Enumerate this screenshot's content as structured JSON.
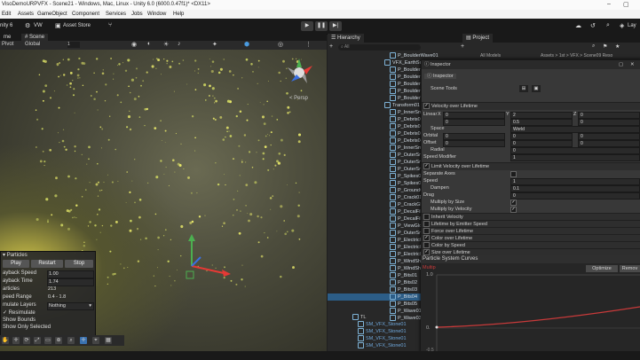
{
  "window": {
    "title": "VisoDemoURPVFX - Scene21 - Windows, Mac, Linux - Unity 6.0 (6000.0.47f1)* <DX11>"
  },
  "menubar": [
    "Edit",
    "Assets",
    "GameObject",
    "Component",
    "Services",
    "Jobs",
    "Window",
    "Help"
  ],
  "toolbar": {
    "account": "nity 6",
    "vw": "VW",
    "asset_store": "Asset Store",
    "layers": "Lay"
  },
  "tabs": {
    "scene_prefix": "me",
    "scene": "Scene",
    "hierarchy": "Hierarchy",
    "project": "Project"
  },
  "scene_toolbar": {
    "pivot": "Pivot",
    "global": "Global",
    "snap": "1"
  },
  "gizmo": {
    "label": "< Persp"
  },
  "hierarchy": {
    "search_placeholder": "All",
    "items": [
      "P_BoulderWave01",
      "VFX_EarthSum",
      "P_BoulderBa",
      "P_BoulderBa",
      "P_BoulderEm",
      "P_BoulderBa",
      "P_BoulderWa",
      "Transform01",
      "P_InnerSmok",
      "P_Debris01",
      "P_Debris03",
      "P_Debris02",
      "P_Debris04",
      "P_InnerSmok",
      "P_OuterSmok",
      "P_OuterSmok",
      "P_OuterSmok",
      "P_Spikes01",
      "P_Spikes02",
      "P_GroundGlo",
      "P_Crack01",
      "P_CrackGlow",
      "P_DecalFill01",
      "P_DecalFill01",
      "P_ViewGlow",
      "P_OuterSmok",
      "P_Electric01",
      "P_Electric02",
      "P_Electric03",
      "P_WindShock",
      "P_WindShock",
      "P_Bits01",
      "P_Bits02",
      "P_Bits03",
      "P_Bits04",
      "P_Bits05",
      "P_Wave01",
      "P_Wave03"
    ],
    "footer_items": [
      "TL",
      "SM_VFX_Stone01",
      "SM_VFX_Stone01",
      "SM_VFX_Stone01",
      "SM_VFX_Stone01"
    ]
  },
  "project": {
    "breadcrumb": "Assets > 1st > VFX > Scene09 Reso",
    "all_models": "All Models"
  },
  "inspector": {
    "window_title": "Inspector",
    "tab": "Inspector",
    "scene_tools": "Scene Tools",
    "velocity_over_lifetime": "Velocity over Lifetime",
    "linear": {
      "label": "Linear",
      "x": "0",
      "y": "2",
      "z": "0"
    },
    "linear_row2": {
      "x": "0",
      "y": "0.5",
      "z": "0"
    },
    "space": {
      "label": "Space",
      "value": "World"
    },
    "orbital": {
      "label": "Orbital",
      "x": "0",
      "y": "0",
      "z": "0"
    },
    "offset": {
      "label": "Offset",
      "x": "0",
      "y": "0",
      "z": "0"
    },
    "radial": {
      "label": "Radial",
      "value": "0"
    },
    "speed_modifier": {
      "label": "Speed Modifier",
      "value": "1"
    },
    "limit_velocity": "Limit Velocity over Lifetime",
    "separate_axes": "Separate Axes",
    "speed": {
      "label": "Speed",
      "value": "1"
    },
    "dampen": {
      "label": "Dampen",
      "value": "0.1"
    },
    "drag": {
      "label": "Drag",
      "value": "0"
    },
    "multiply_size": "Multiply by Size",
    "multiply_velocity": "Multiply by Velocity",
    "modules": [
      "Inherit Velocity",
      "Lifetime by Emitter Speed",
      "Force over Lifetime",
      "Color over Lifetime",
      "Color by Speed",
      "Size over Lifetime"
    ]
  },
  "curves": {
    "title": "Particle System Curves",
    "optimize": "Optimize",
    "remove": "Remov",
    "curve_label": "Multip",
    "top_value": "1.0",
    "mid_value": "0.",
    "bottom_value": "-0.5"
  },
  "particles": {
    "title": "Particles",
    "play": "Play",
    "restart": "Restart",
    "stop": "Stop",
    "rows": [
      {
        "label": "ayback Speed",
        "value": "1.00"
      },
      {
        "label": "ayback Time",
        "value": "1.74"
      },
      {
        "label": "articles",
        "value": "213"
      },
      {
        "label": "peed Range",
        "value": "0.4 - 1.8"
      },
      {
        "label": "mulate Layers",
        "value": "Nothing"
      }
    ],
    "resimulate": "Resimulate",
    "show_bounds": "Show Bounds",
    "show_only_selected": "Show Only Selected"
  },
  "colors": {
    "accent": "#3a72b0",
    "curve": "#c83a3a",
    "selected": "#2c5d87"
  }
}
